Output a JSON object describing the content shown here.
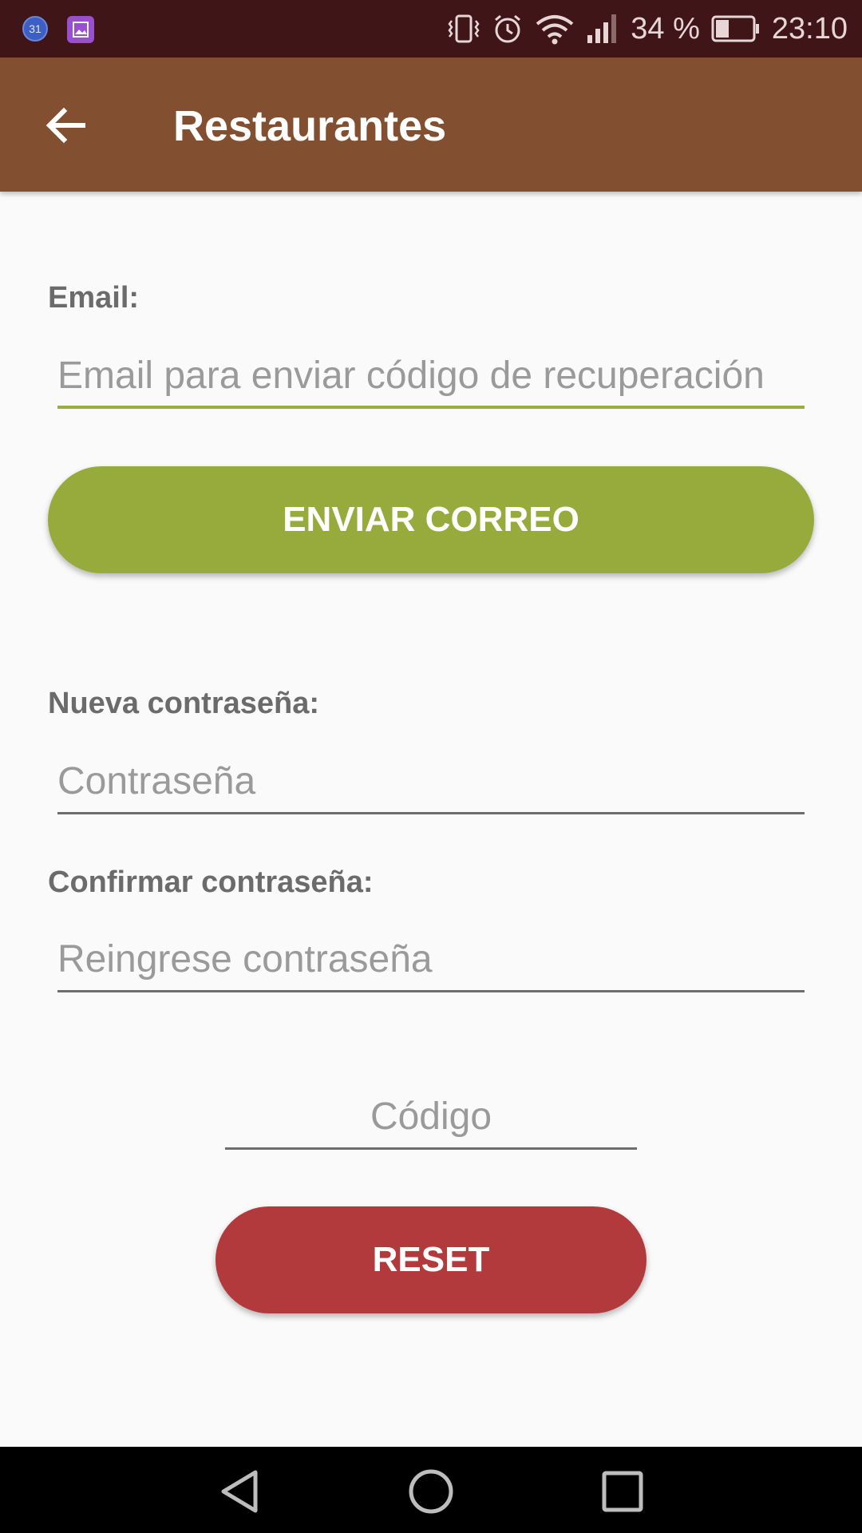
{
  "status_bar": {
    "battery": "34 %",
    "time": "23:10",
    "calendar_badge": "31"
  },
  "app_bar": {
    "title": "Restaurantes"
  },
  "form": {
    "email_label": "Email:",
    "email_placeholder": "Email para enviar código de recuperación",
    "send_button": "ENVIAR CORREO",
    "new_password_label": "Nueva contraseña:",
    "new_password_placeholder": "Contraseña",
    "confirm_password_label": "Confirmar contraseña:",
    "confirm_password_placeholder": "Reingrese contraseña",
    "code_placeholder": "Código",
    "reset_button": "RESET"
  },
  "colors": {
    "status_bar": "#3f1518",
    "app_bar": "#825031",
    "accent_green": "#97ab3d",
    "reset_red": "#b33a3c"
  }
}
